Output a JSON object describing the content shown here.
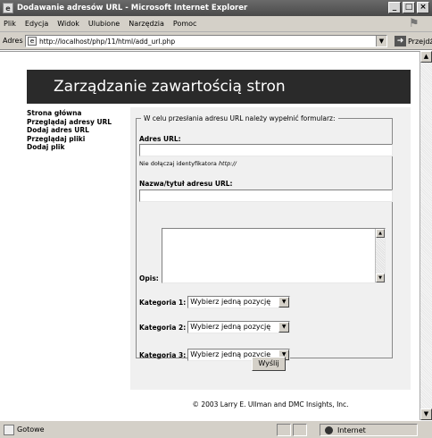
{
  "window": {
    "title": "Dodawanie adresów URL - Microsoft Internet Explorer",
    "controls": [
      "_",
      "□",
      "×"
    ]
  },
  "menu": {
    "items": [
      "Plik",
      "Edycja",
      "Widok",
      "Ulubione",
      "Narzędzia",
      "Pomoc"
    ]
  },
  "address": {
    "label": "Adres",
    "url": "http://localhost/php/11/html/add_url.php",
    "go_label": "Przejdź"
  },
  "page": {
    "banner": "Zarządzanie zawartością stron",
    "nav": [
      "Strona główna",
      "Przeglądaj adresy URL",
      "Dodaj adres URL",
      "Przeglądaj pliki",
      "Dodaj plik"
    ],
    "form": {
      "legend": "W celu przesłania adresu URL należy wypełnić formularz:",
      "url_label": "Adres URL:",
      "url_value": "",
      "url_hint_prefix": "Nie dołączaj identyfikatora ",
      "url_hint_em": "http://",
      "title_label": "Nazwa/tytuł adresu URL:",
      "title_value": "",
      "desc_label": "Opis:",
      "desc_value": "",
      "categories": [
        {
          "label": "Kategoria 1:",
          "selected": "Wybierz jedną pozycję"
        },
        {
          "label": "Kategoria 2:",
          "selected": "Wybierz jedną pozycję"
        },
        {
          "label": "Kategoria 3:",
          "selected": "Wybierz jedną pozycję"
        }
      ],
      "submit_label": "Wyślij"
    },
    "footer": "© 2003 Larry E. Ullman and DMC Insights, Inc."
  },
  "status": {
    "text": "Gotowe",
    "zone": "Internet"
  }
}
